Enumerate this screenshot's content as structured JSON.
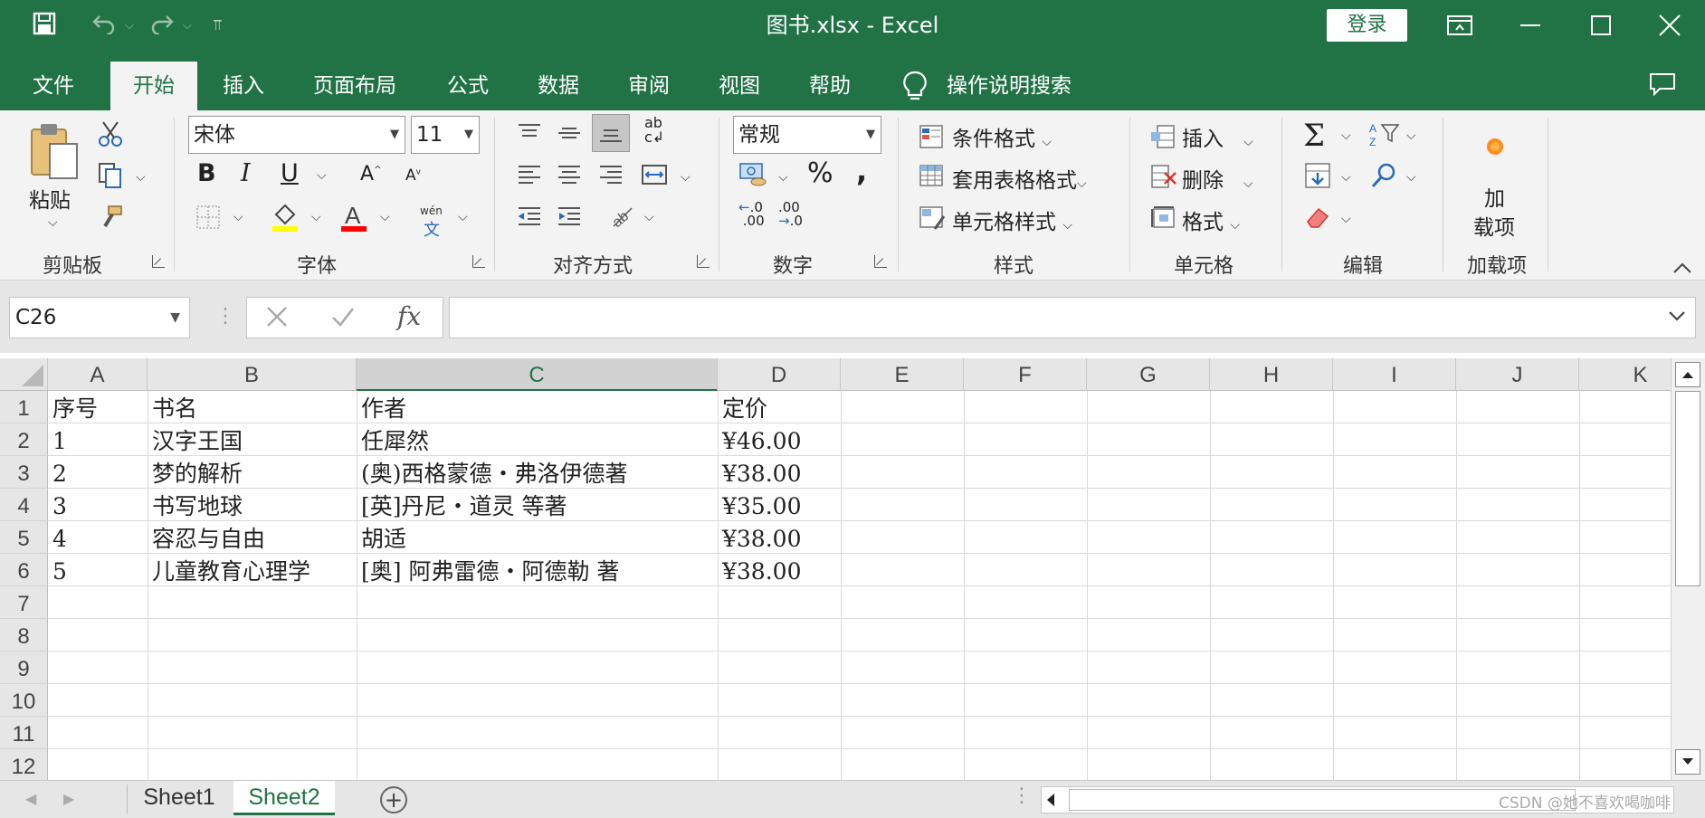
{
  "window": {
    "title": "图书.xlsx  -  Excel",
    "login_label": "登录"
  },
  "menu": {
    "tabs": [
      "文件",
      "开始",
      "插入",
      "页面布局",
      "公式",
      "数据",
      "审阅",
      "视图",
      "帮助"
    ],
    "active_tab": "开始",
    "search_label": "操作说明搜索"
  },
  "ribbon": {
    "clipboard": {
      "paste_label": "粘贴",
      "group_label": "剪贴板"
    },
    "font": {
      "font_name": "宋体",
      "font_size": "11",
      "group_label": "字体",
      "phonetic_label": "wén"
    },
    "alignment": {
      "group_label": "对齐方式",
      "wrap_label": "ab"
    },
    "number": {
      "format": "常规",
      "percent": "%",
      "comma": ",",
      "inc_decimal": ".0",
      "dec_decimal": ".00",
      "group_label": "数字"
    },
    "styles": {
      "conditional": "条件格式",
      "table": "套用表格格式",
      "cell_styles": "单元格样式",
      "group_label": "样式"
    },
    "cells": {
      "insert": "插入",
      "delete": "删除",
      "format": "格式",
      "group_label": "单元格"
    },
    "editing": {
      "group_label": "编辑"
    },
    "addins": {
      "label_line1": "加",
      "label_line2": "载项",
      "group_label": "加载项"
    }
  },
  "formula_bar": {
    "name_box": "C26",
    "fx": "fx",
    "content": ""
  },
  "grid": {
    "selected_column": "C",
    "columns": [
      "A",
      "B",
      "C",
      "D",
      "E",
      "F",
      "G",
      "H",
      "I",
      "J",
      "K"
    ],
    "row_numbers": [
      "1",
      "2",
      "3",
      "4",
      "5",
      "6",
      "7",
      "8",
      "9",
      "10",
      "11",
      "12"
    ],
    "rows": [
      [
        "序号",
        "书名",
        "作者",
        "定价"
      ],
      [
        "1",
        "汉字王国",
        "任犀然",
        "¥46.00"
      ],
      [
        "2",
        "梦的解析",
        "(奥)西格蒙德・弗洛伊德著",
        "¥38.00"
      ],
      [
        "3",
        "书写地球",
        "[英]丹尼・道灵 等著",
        "¥35.00"
      ],
      [
        "4",
        "容忍与自由",
        "胡适",
        "¥38.00"
      ],
      [
        "5",
        "儿童教育心理学",
        "[奥] 阿弗雷德・阿德勒 著",
        "¥38.00"
      ]
    ]
  },
  "sheets": {
    "tabs": [
      "Sheet1",
      "Sheet2"
    ],
    "active": "Sheet2"
  },
  "watermark": "CSDN @她不喜欢喝咖啡",
  "colors": {
    "excel_green": "#217346",
    "ribbon_bg": "#f3f3f3",
    "header_bg": "#e6e6e6"
  }
}
